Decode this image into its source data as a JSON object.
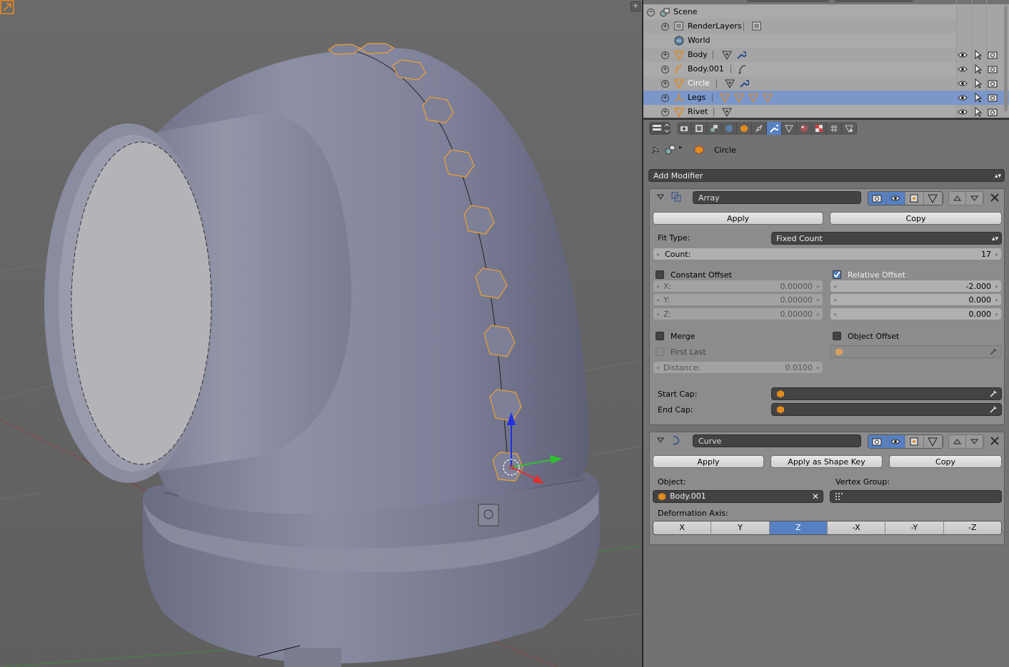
{
  "outliner": {
    "rows": [
      {
        "name": "Scene",
        "icon": "scene-icon"
      },
      {
        "name": "RenderLayers",
        "icon": "renderlayers-icon"
      },
      {
        "name": "World",
        "icon": "world-icon"
      },
      {
        "name": "Body",
        "icon": "mesh-object-icon"
      },
      {
        "name": "Body.001",
        "icon": "curve-object-icon"
      },
      {
        "name": "Circle",
        "icon": "mesh-object-icon",
        "active": true
      },
      {
        "name": "Legs",
        "icon": "empty-object-icon",
        "selected": true
      },
      {
        "name": "Rivet",
        "icon": "mesh-object-icon"
      }
    ]
  },
  "properties": {
    "breadcrumb": {
      "pin_icon": "pin-icon",
      "scene_icon": "scene-icon",
      "object_icon": "object-icon",
      "object_name": "Circle"
    },
    "add_modifier": "Add Modifier",
    "array": {
      "name": "Array",
      "apply": "Apply",
      "copy": "Copy",
      "fit_type_label": "Fit Type:",
      "fit_type_value": "Fixed Count",
      "count_label": "Count:",
      "count_value": "17",
      "constant_offset_label": "Constant Offset",
      "constant_offset_checked": false,
      "relative_offset_label": "Relative Offset",
      "relative_offset_checked": true,
      "constant": [
        {
          "label": "X:",
          "value": "0.00000"
        },
        {
          "label": "Y:",
          "value": "0.00000"
        },
        {
          "label": "Z:",
          "value": "0.00000"
        }
      ],
      "relative": [
        "-2.000",
        "0.000",
        "0.000"
      ],
      "merge_label": "Merge",
      "first_last_label": "First Last",
      "object_offset_label": "Object Offset",
      "distance_label": "Distance:",
      "distance_value": "0.0100",
      "start_cap_label": "Start Cap:",
      "end_cap_label": "End Cap:"
    },
    "curve": {
      "name": "Curve",
      "apply": "Apply",
      "apply_shape_key": "Apply as Shape Key",
      "copy": "Copy",
      "object_label": "Object:",
      "object_value": "Body.001",
      "vertex_group_label": "Vertex Group:",
      "deformation_axis_label": "Deformation Axis:",
      "axes": [
        "X",
        "Y",
        "Z",
        "-X",
        "-Y",
        "-Z"
      ],
      "selected_axis": "Z"
    }
  },
  "colors": {
    "accent": "#5680c2",
    "selection_outline": "#f0a030",
    "panel_bg": "#8c8c8c"
  }
}
